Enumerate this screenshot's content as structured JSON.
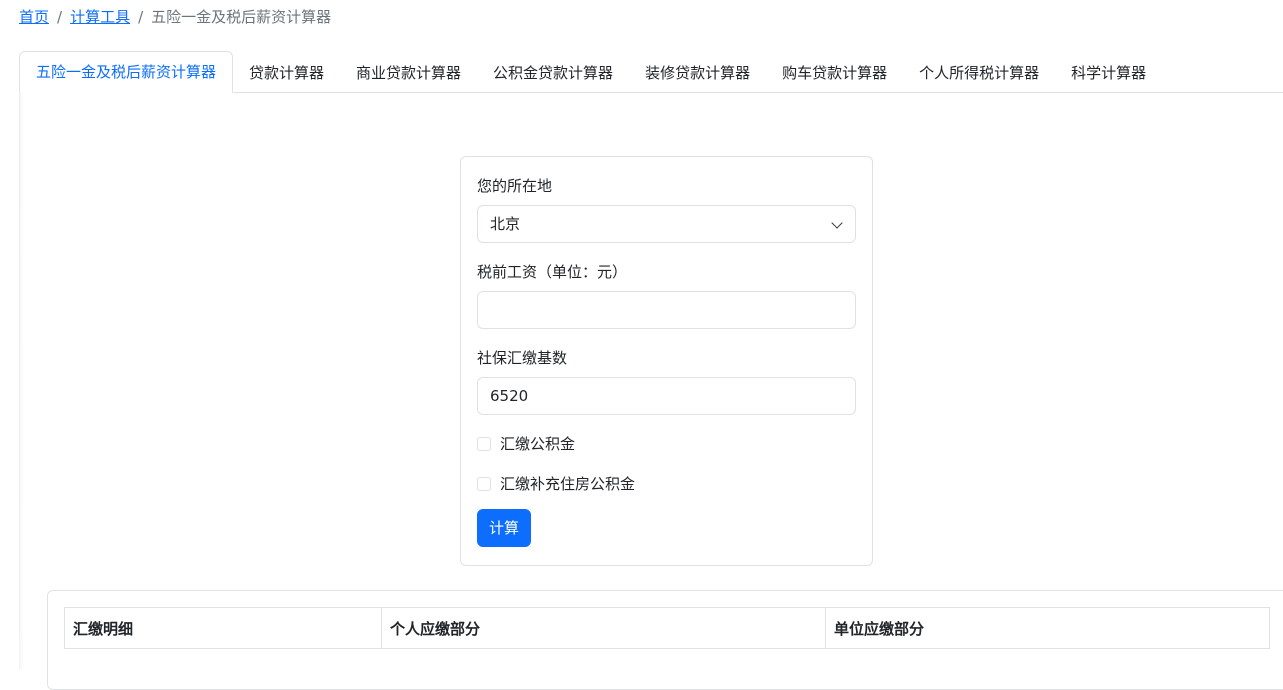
{
  "breadcrumb": {
    "home": "首页",
    "tools": "计算工具",
    "current": "五险一金及税后薪资计算器",
    "separator": "/"
  },
  "tabs": [
    {
      "label": "五险一金及税后薪资计算器",
      "active": true
    },
    {
      "label": "贷款计算器",
      "active": false
    },
    {
      "label": "商业贷款计算器",
      "active": false
    },
    {
      "label": "公积金贷款计算器",
      "active": false
    },
    {
      "label": "装修贷款计算器",
      "active": false
    },
    {
      "label": "购车贷款计算器",
      "active": false
    },
    {
      "label": "个人所得税计算器",
      "active": false
    },
    {
      "label": "科学计算器",
      "active": false
    }
  ],
  "form": {
    "location_label": "您的所在地",
    "location_value": "北京",
    "salary_label": "税前工资（单位：元）",
    "salary_value": "",
    "base_label": "社保汇缴基数",
    "base_value": "6520",
    "housing_fund_label": "汇缴公积金",
    "supplementary_fund_label": "汇缴补充住房公积金",
    "submit_label": "计算"
  },
  "result": {
    "headers": [
      "汇缴明细",
      "个人应缴部分",
      "单位应缴部分"
    ]
  },
  "colors": {
    "accent": "#0d6efd",
    "border": "#dee2e6"
  }
}
